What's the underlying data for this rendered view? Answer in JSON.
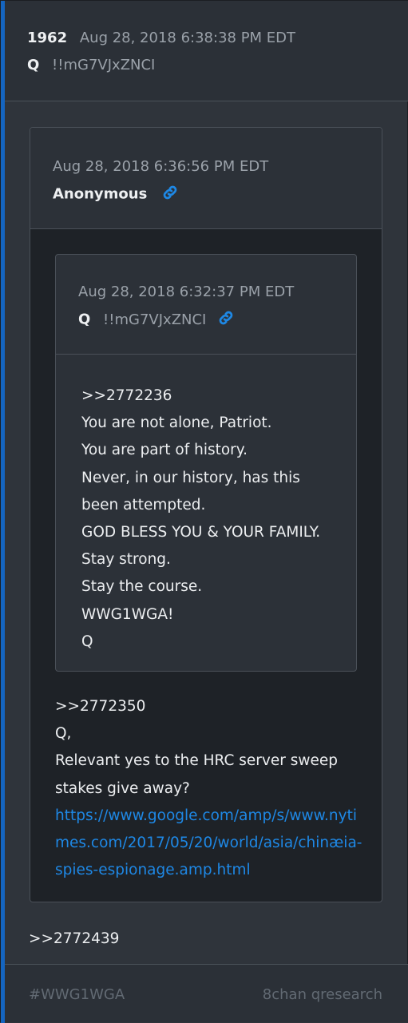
{
  "post": {
    "number": "1962",
    "timestamp": "Aug 28, 2018 6:38:38 PM EDT",
    "author": "Q",
    "tripcode": "!!mG7VJxZNCI"
  },
  "quoted_post": {
    "timestamp": "Aug 28, 2018 6:36:56 PM EDT",
    "author": "Anonymous",
    "nested_quote": {
      "timestamp": "Aug 28, 2018 6:32:37 PM EDT",
      "author": "Q",
      "tripcode": "!!mG7VJxZNCI",
      "lines": [
        ">>2772236",
        "You are not alone, Patriot.",
        "You are part of history.",
        "Never, in our history, has this",
        "been attempted.",
        "GOD BLESS YOU & YOUR FAMILY.",
        "Stay strong.",
        "Stay the course.",
        "WWG1WGA!",
        "Q"
      ]
    },
    "lines": [
      ">>2772350",
      "Q,",
      "Relevant yes to the HRC server sweep stakes give away?"
    ],
    "link": "https://www.google.com/amp/s/www.nytimes.com/2017/05/20/world/asia/chinæia-spies-espionage.amp.html"
  },
  "reply": ">>2772439",
  "footer": {
    "tag": "#WWG1WGA",
    "source": "8chan qresearch"
  },
  "colors": {
    "accent": "#1565c0",
    "link": "#1e88e5",
    "background": "#2f343b"
  },
  "icons": {
    "link": "link-icon"
  }
}
